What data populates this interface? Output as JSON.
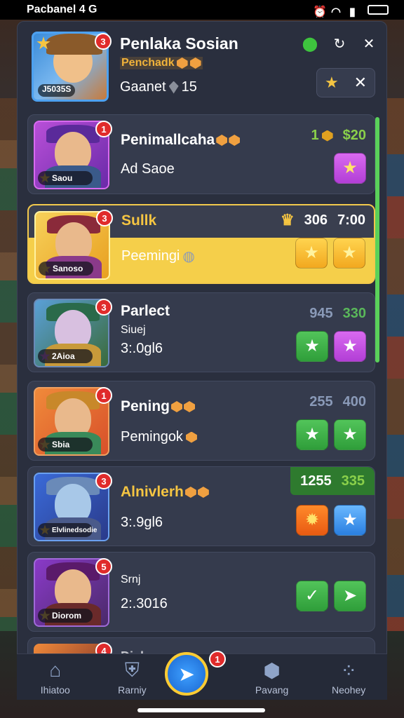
{
  "status_bar": {
    "time": "Pacbanel 4 G",
    "icons": [
      "alarm-icon",
      "wifi-icon",
      "signal-icon",
      "battery-icon"
    ]
  },
  "header": {
    "title": "Penlaka Sosian",
    "subtitle": "Penchadk",
    "meta_label": "Gaanet",
    "meta_value": "15",
    "avatar_badge": "3",
    "avatar_tag": "J5035S",
    "icons": [
      "green-gem-icon",
      "refresh-icon",
      "close-icon"
    ],
    "pill_icons": [
      "star-icon",
      "close-icon"
    ]
  },
  "list": [
    {
      "name": "Penimallcaha",
      "sub": "Ad Saoe",
      "stat1": "1",
      "stat2": "$20",
      "tag": "Saou",
      "badge": "1",
      "buttons": [
        "pink-star"
      ]
    },
    {
      "name": "Sullk",
      "sub": "Peemingi",
      "stat1": "306",
      "stat2": "7:00",
      "tag": "Sanoso",
      "badge": "3",
      "buttons": [
        "yellow-star",
        "yellow-star"
      ],
      "highlight": true
    },
    {
      "name": "Parlect",
      "sub_small": "Siuej",
      "sub": "3:.0gl6",
      "stat1": "945",
      "stat2": "330",
      "tag": "2Aioa",
      "badge": "3",
      "buttons": [
        "green-star",
        "pink-star"
      ]
    },
    {
      "name": "Pening",
      "sub": "Pemingok",
      "stat1": "255",
      "stat2": "400",
      "tag": "Sbia",
      "badge": "1",
      "buttons": [
        "green-star",
        "green-star"
      ]
    },
    {
      "name": "Alnivlerh",
      "sub": "3:.9gl6",
      "stat1": "1255",
      "stat2": "335",
      "tag": "Elvlinedsodie",
      "badge": "3",
      "buttons": [
        "orange-gear",
        "blue-star"
      ]
    },
    {
      "name": "",
      "sub_small": "Srnj",
      "sub": "2:.3016",
      "stat1": "",
      "stat2": "",
      "tag": "Diorom",
      "badge": "5",
      "buttons": [
        "green-check",
        "green-arrow"
      ]
    }
  ],
  "partial_row": {
    "name": "Dialogg",
    "badge": "4"
  },
  "bottom_nav": [
    {
      "label": "Ihiatoo",
      "icon": "home-icon"
    },
    {
      "label": "Rarniy",
      "icon": "shield-icon"
    },
    {
      "label": "",
      "icon": "send-icon",
      "badge": "1"
    },
    {
      "label": "Pavang",
      "icon": "box-icon"
    },
    {
      "label": "Neohey",
      "icon": "dots-icon"
    }
  ],
  "colors": {
    "accent": "#f2c94c",
    "panel": "#2a2f3e",
    "row": "#353b4d",
    "green": "#52c45a",
    "pink": "#d96af0"
  }
}
